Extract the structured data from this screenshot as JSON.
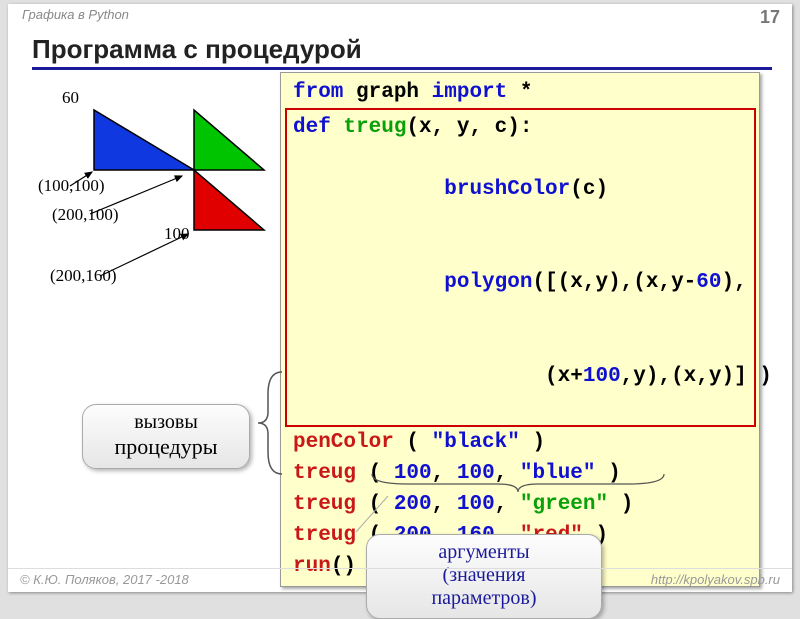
{
  "header": {
    "subject": "Графика в Python",
    "page": "17"
  },
  "title": "Программа с процедурой",
  "diagram": {
    "label_60": "60",
    "label_p1": "(100,100)",
    "label_p2": "(200,100)",
    "label_100": "100",
    "label_p3": "(200,160)"
  },
  "code": {
    "l01a": "from",
    "l01b": " graph ",
    "l01c": "import",
    "l01d": " *",
    "l02a": "def",
    "l02b": " treug",
    "l02c": "(x, y, c):",
    "l03a": "  brushColor",
    "l03b": "(c)",
    "l04a": "  polygon",
    "l04b": "([(x,y),(x,y-",
    "l04c": "60",
    "l04d": "),",
    "l05a": "          (x+",
    "l05b": "100",
    "l05c": ",y),(x,y)] )",
    "l06a": "penColor",
    "l06b": " ( ",
    "l06c": "\"black\"",
    "l06d": " )",
    "l07a": "treug",
    "l07b": " ( ",
    "l07c": "100",
    "l07d": ", ",
    "l07e": "100",
    "l07f": ", ",
    "l07g": "\"blue\"",
    "l07h": " )",
    "l08a": "treug",
    "l08b": " ( ",
    "l08c": "200",
    "l08d": ", ",
    "l08e": "100",
    "l08f": ", ",
    "l08g": "\"green\"",
    "l08h": " )",
    "l09a": "treug",
    "l09b": " ( ",
    "l09c": "200",
    "l09d": ", ",
    "l09e": "160",
    "l09f": ", ",
    "l09g": "\"red\"",
    "l09h": " )",
    "l10a": "run",
    "l10b": "()"
  },
  "callouts": {
    "c1_line1": "вызовы",
    "c1_line2": "процедуры",
    "c2_line1": "аргументы",
    "c2_line2": "(значения",
    "c2_line3": "параметров)"
  },
  "footer": {
    "left": "© К.Ю. Поляков, 2017 -2018",
    "right": "http://kpolyakov.spb.ru"
  }
}
